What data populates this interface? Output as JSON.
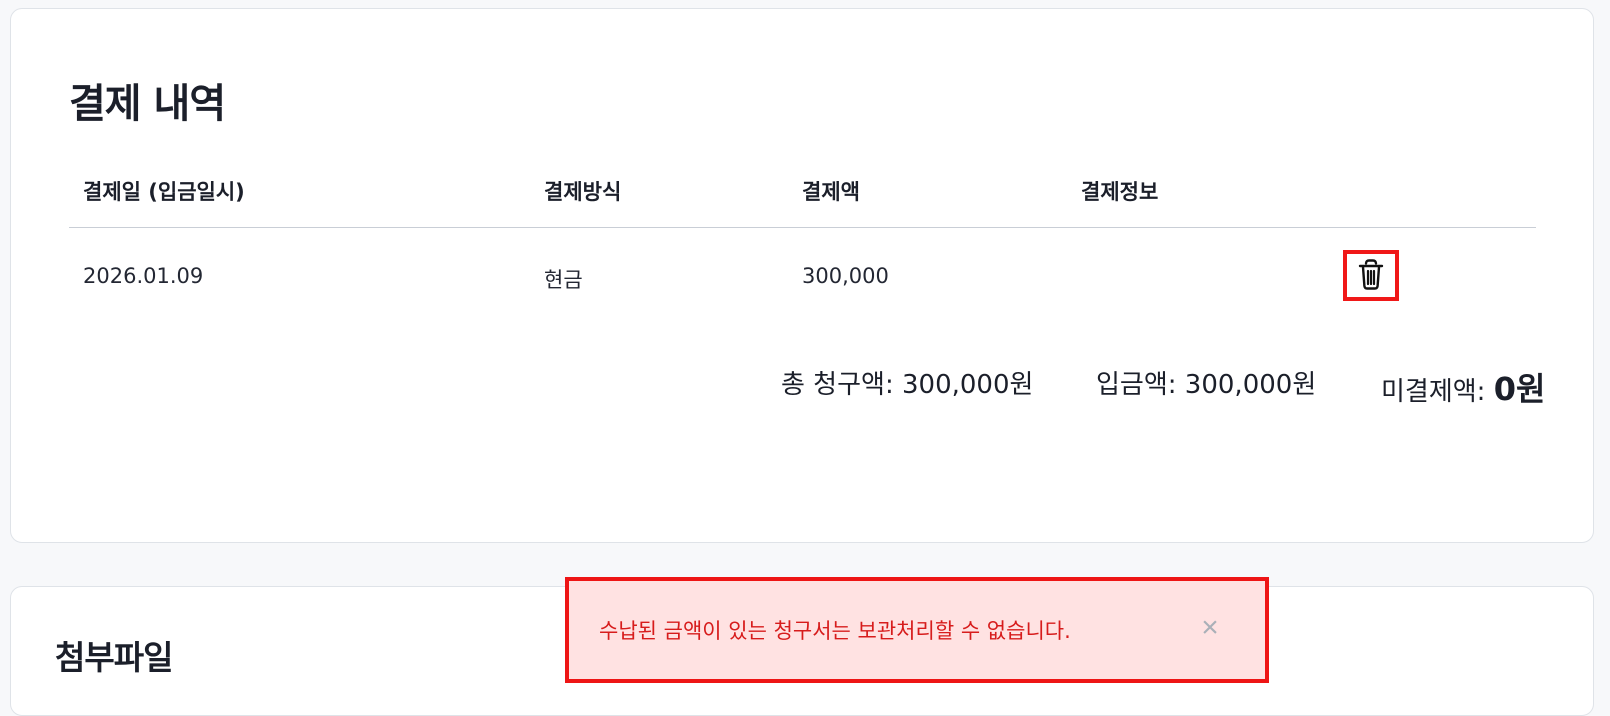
{
  "payments": {
    "title": "결제 내역",
    "columns": {
      "date": "결제일 (입금일시)",
      "method": "결제방식",
      "amount": "결제액",
      "info": "결제정보"
    },
    "rows": [
      {
        "date": "2026.01.09",
        "method": "현금",
        "amount": "300,000",
        "info": ""
      }
    ],
    "summary": {
      "total_label": "총 청구액:",
      "total_value": "300,000원",
      "paid_label": "입금액:",
      "paid_value": "300,000원",
      "unpaid_label": "미결제액:",
      "unpaid_value": "0원"
    },
    "icons": {
      "delete": "trash-icon"
    }
  },
  "attachments": {
    "title": "첨부파일"
  },
  "toast": {
    "message": "수납된 금액이 있는 청구서는 보관처리할 수 없습니다.",
    "close_symbol": "×",
    "status_color": "#d71c1c"
  }
}
